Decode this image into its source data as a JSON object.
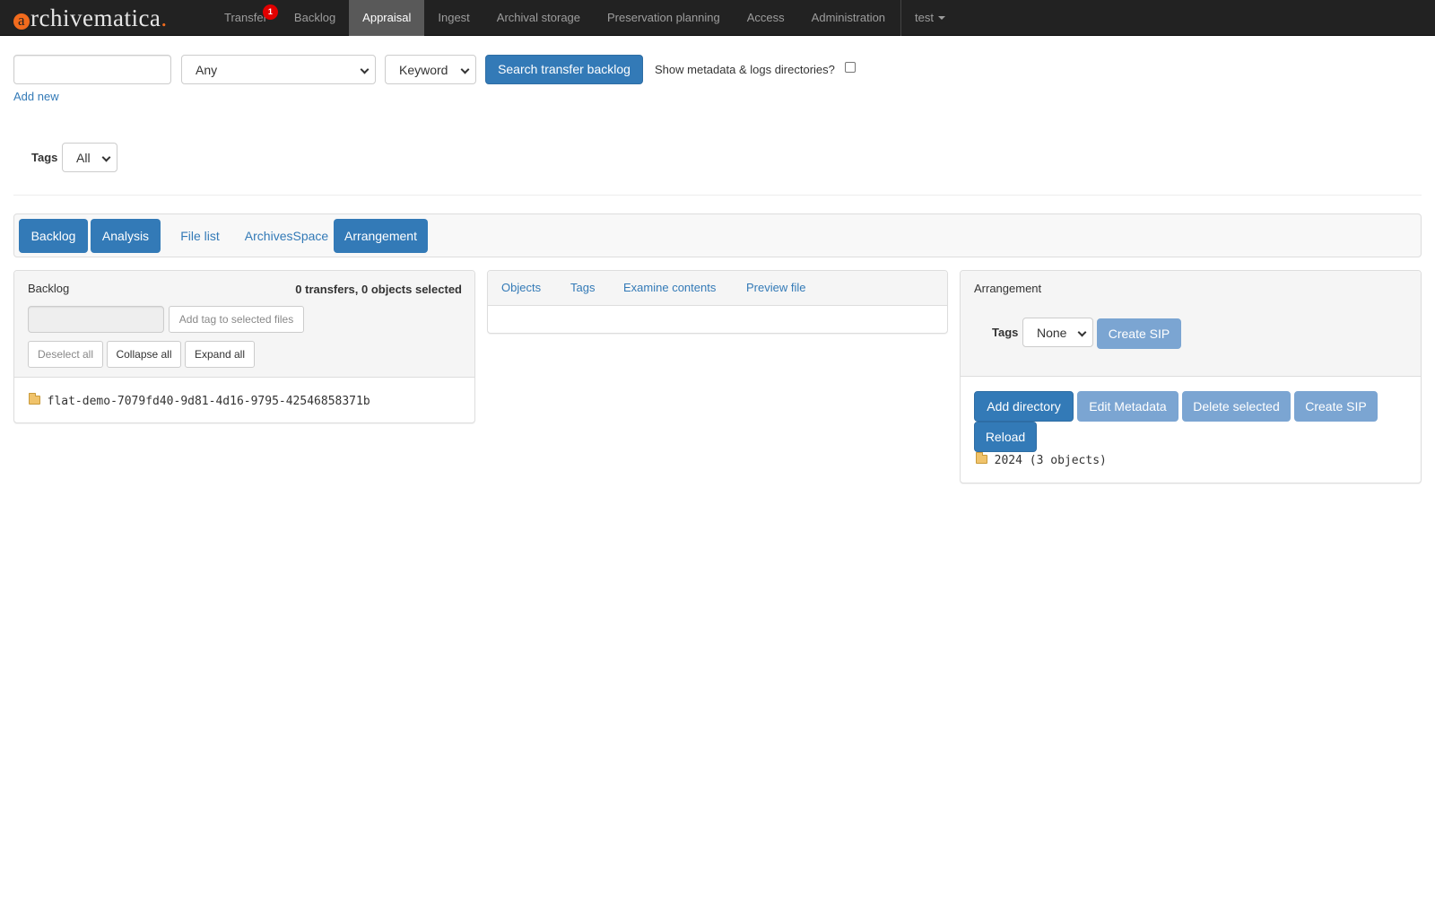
{
  "brand": {
    "letter": "a",
    "rest": "rchivematica",
    "dot": "."
  },
  "nav": {
    "items": [
      {
        "label": "Transfer",
        "badge": "1"
      },
      {
        "label": "Backlog"
      },
      {
        "label": "Appraisal"
      },
      {
        "label": "Ingest"
      },
      {
        "label": "Archival storage"
      },
      {
        "label": "Preservation planning"
      },
      {
        "label": "Access"
      },
      {
        "label": "Administration"
      }
    ],
    "active": "Appraisal",
    "user": "test"
  },
  "search": {
    "query_value": "",
    "field_select": "Any",
    "type_select": "Keyword",
    "search_button": "Search transfer backlog",
    "show_metadata_label": "Show metadata & logs directories?",
    "show_metadata_checked": false,
    "add_new": "Add new"
  },
  "tags_filter": {
    "label": "Tags",
    "value": "All"
  },
  "tabs": [
    {
      "label": "Backlog",
      "active": true
    },
    {
      "label": "Analysis",
      "active": true
    },
    {
      "label": "File list",
      "active": false
    },
    {
      "label": "ArchivesSpace",
      "active": false
    },
    {
      "label": "Arrangement",
      "active": true
    }
  ],
  "backlog_panel": {
    "title": "Backlog",
    "selection_summary": "0 transfers, 0 objects selected",
    "tag_input_value": "",
    "add_tag_button": "Add tag to selected files",
    "deselect_all": "Deselect all",
    "collapse_all": "Collapse all",
    "expand_all": "Expand all",
    "tree": [
      {
        "name": "flat-demo-7079fd40-9d81-4d16-9795-42546858371b"
      }
    ]
  },
  "analysis_panel": {
    "tabs": [
      "Objects",
      "Tags",
      "Examine contents",
      "Preview file"
    ]
  },
  "arrangement_panel": {
    "title": "Arrangement",
    "tags_label": "Tags",
    "tags_value": "None",
    "create_sip_head": "Create SIP",
    "buttons": {
      "add_directory": "Add directory",
      "edit_metadata": "Edit Metadata",
      "delete_selected": "Delete selected",
      "create_sip": "Create SIP",
      "reload": "Reload"
    },
    "tree": [
      {
        "name": "2024 (3 objects)"
      }
    ]
  },
  "colors": {
    "navbar": "#222222",
    "primary": "#337ab7",
    "primary_disabled": "#7ba5d2",
    "badge": "#e10000",
    "brand_accent": "#f26b1d"
  }
}
